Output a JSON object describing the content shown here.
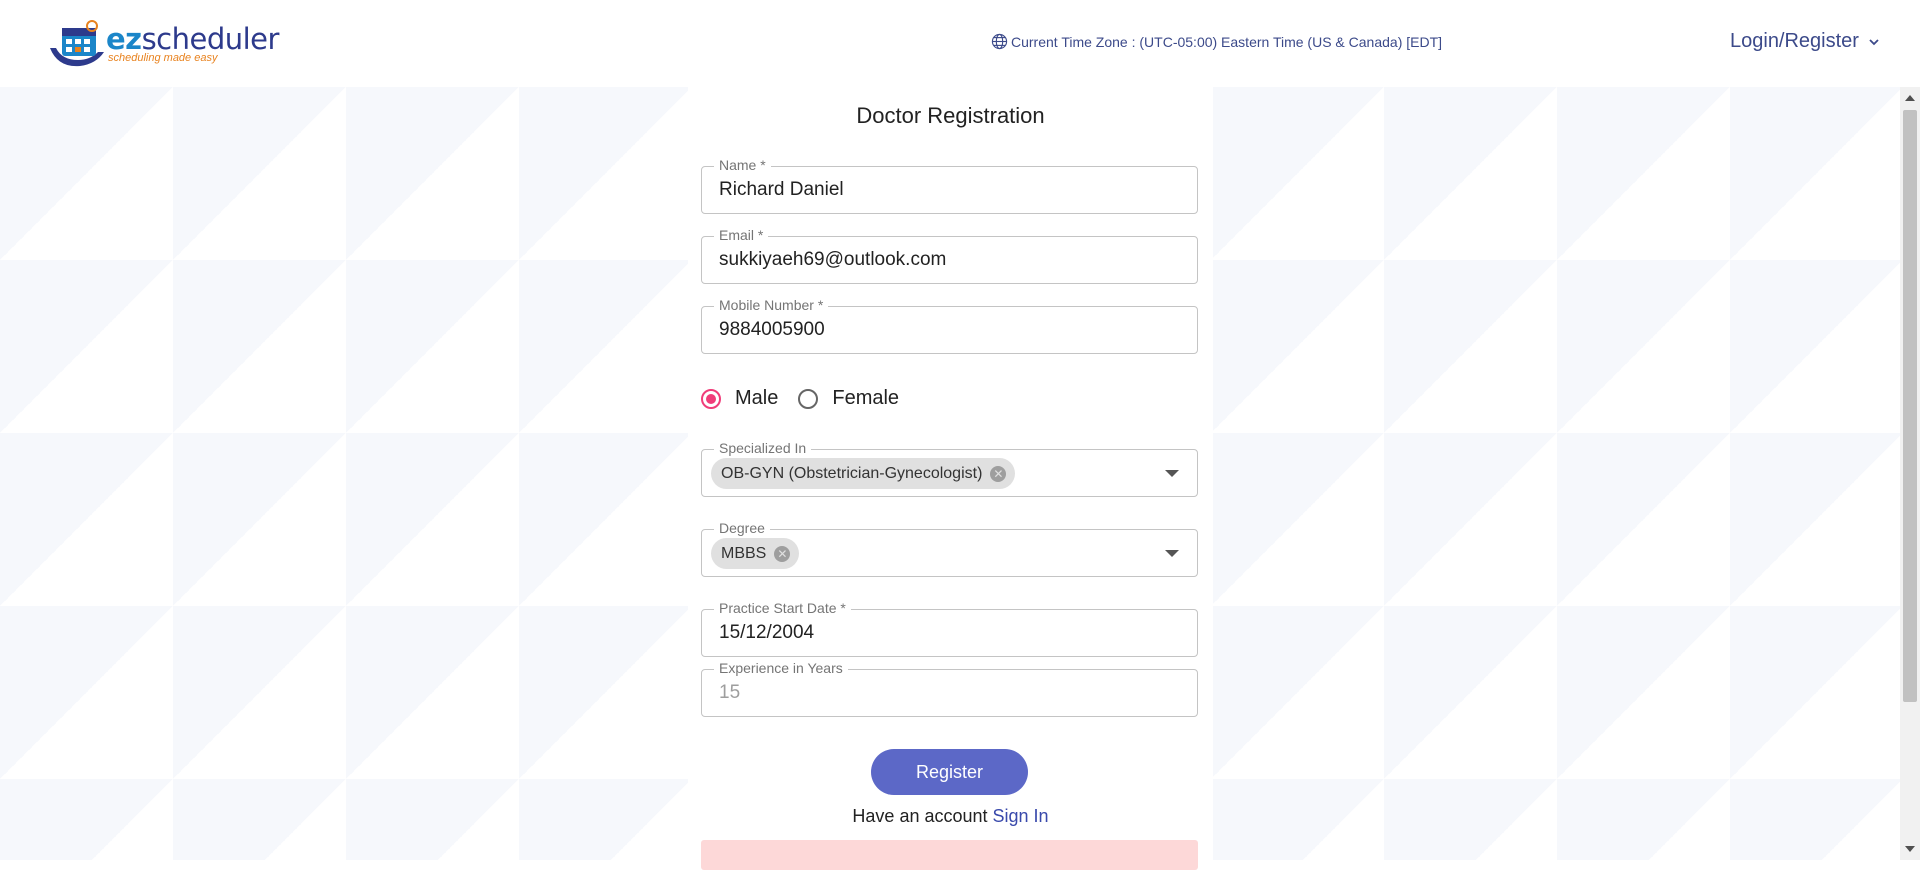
{
  "header": {
    "logo_text_ez": "ez",
    "logo_text_rest": "scheduler",
    "logo_tagline": "scheduling made easy",
    "timezone": "Current Time Zone : (UTC-05:00) Eastern Time (US & Canada) [EDT]",
    "login_label": "Login/Register"
  },
  "form": {
    "title": "Doctor Registration",
    "name": {
      "label": "Name *",
      "value": "Richard Daniel"
    },
    "email": {
      "label": "Email *",
      "value": "sukkiyaeh69@outlook.com"
    },
    "mobile": {
      "label": "Mobile Number *",
      "value": "9884005900"
    },
    "gender": {
      "options": [
        "Male",
        "Female"
      ],
      "selected": "Male"
    },
    "specialized": {
      "label": "Specialized In",
      "chip": "OB-GYN (Obstetrician-Gynecologist)"
    },
    "degree": {
      "label": "Degree",
      "chip": "MBBS"
    },
    "practice_start": {
      "label": "Practice Start Date *",
      "value": "15/12/2004"
    },
    "experience": {
      "label": "Experience in Years",
      "value": "15"
    },
    "register_label": "Register",
    "have_account": "Have an account",
    "sign_in": "Sign In"
  },
  "colors": {
    "accent": "#5c68c7",
    "radio_selected": "#f03d7a",
    "link": "#3949ab",
    "alert_bg": "#fdd8d8"
  }
}
